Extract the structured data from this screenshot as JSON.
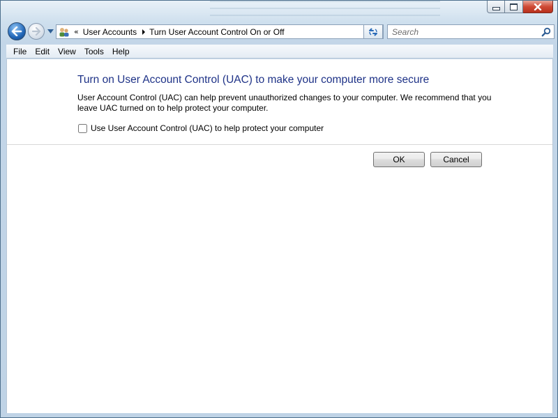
{
  "window": {
    "caption_buttons": {
      "minimize_icon": "minimize-icon",
      "maximize_icon": "maximize-icon",
      "close_icon": "close-icon",
      "close_color": "#c8412f"
    }
  },
  "nav": {
    "back_icon": "back-arrow-icon",
    "forward_icon": "forward-arrow-icon",
    "recent_pages_icon": "chevron-down-icon",
    "address": {
      "location_icon": "user-accounts-icon",
      "overflow_glyph": "«",
      "crumbs": [
        "User Accounts",
        "Turn User Account Control On or Off"
      ]
    },
    "refresh_icon": "refresh-icon",
    "search": {
      "placeholder": "Search",
      "icon": "search-icon"
    }
  },
  "menu": [
    "File",
    "Edit",
    "View",
    "Tools",
    "Help"
  ],
  "main": {
    "heading": "Turn on User Account Control (UAC) to make your computer more secure",
    "heading_color": "#1e3287",
    "description": "User Account Control (UAC) can help prevent unauthorized changes to your computer.  We recommend that you leave UAC turned on to help protect your computer.",
    "checkbox": {
      "label": "Use User Account Control (UAC) to help protect your computer",
      "checked": false
    },
    "buttons": {
      "ok": "OK",
      "cancel": "Cancel"
    }
  }
}
